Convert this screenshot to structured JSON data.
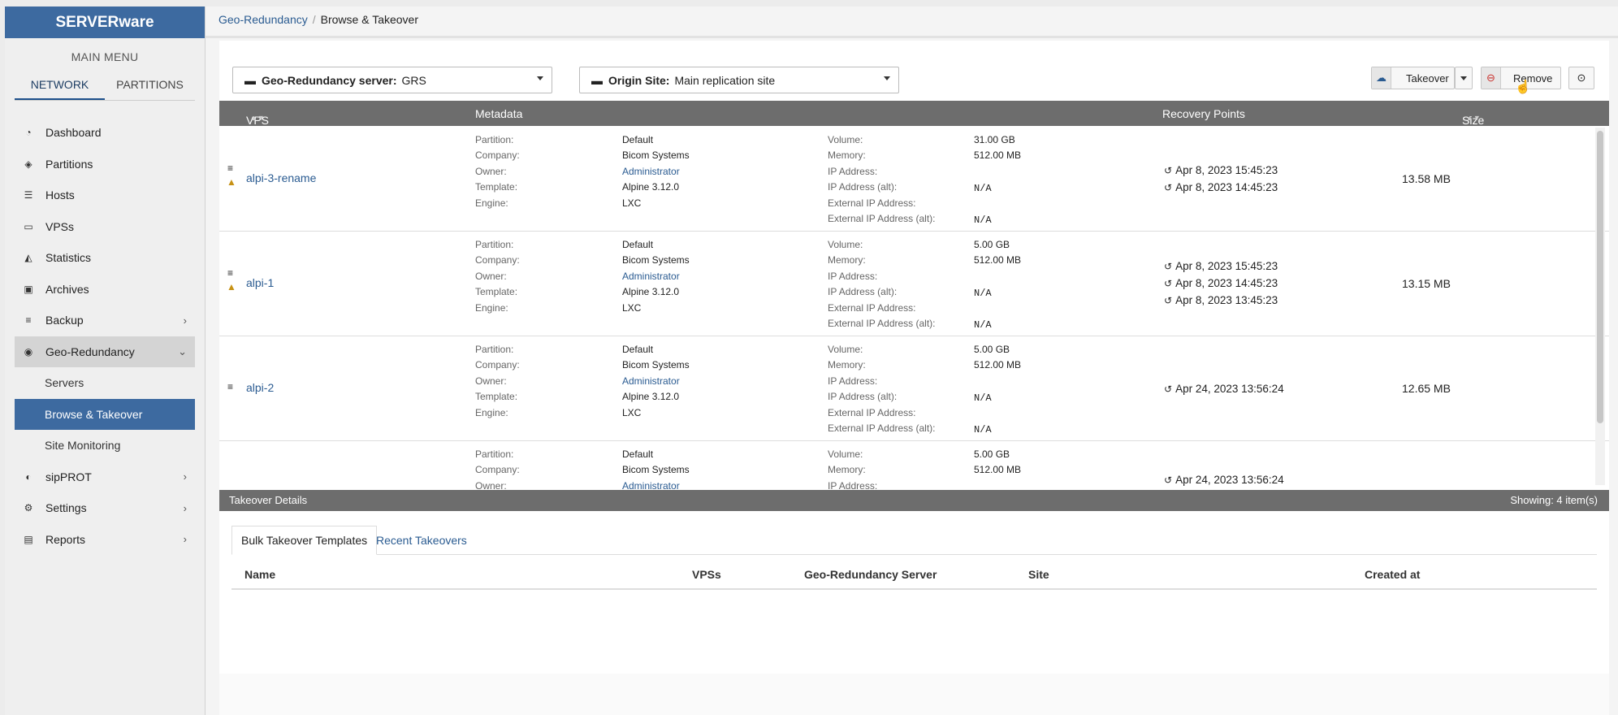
{
  "brand": "SERVERware",
  "menu_title": "MAIN MENU",
  "nav_tabs": [
    "NETWORK",
    "PARTITIONS"
  ],
  "menu": [
    {
      "label": "Dashboard",
      "icon": "dashboard-icon"
    },
    {
      "label": "Partitions",
      "icon": "partitions-icon"
    },
    {
      "label": "Hosts",
      "icon": "hosts-icon"
    },
    {
      "label": "VPSs",
      "icon": "laptop-icon"
    },
    {
      "label": "Statistics",
      "icon": "chart-icon"
    },
    {
      "label": "Archives",
      "icon": "archive-icon"
    },
    {
      "label": "Backup",
      "icon": "database-icon"
    },
    {
      "label": "Geo-Redundancy",
      "icon": "globe-icon"
    },
    {
      "label": "sipPROT",
      "icon": "shield-icon"
    },
    {
      "label": "Settings",
      "icon": "gears-icon"
    },
    {
      "label": "Reports",
      "icon": "report-icon"
    }
  ],
  "submenu": [
    "Servers",
    "Browse & Takeover",
    "Site Monitoring"
  ],
  "breadcrumb": {
    "parent": "Geo-Redundancy",
    "sep": "/",
    "current": "Browse & Takeover"
  },
  "filters": {
    "server_label": "Geo-Redundancy server:",
    "server_value": "GRS",
    "site_label": "Origin Site:",
    "site_value": "Main replication site"
  },
  "actions": {
    "takeover": "Takeover",
    "remove": "Remove"
  },
  "table": {
    "headers": {
      "vps": "VPS",
      "metadata": "Metadata",
      "recovery": "Recovery Points",
      "size": "Size"
    },
    "meta_labels": [
      "Partition:",
      "Company:",
      "Owner:",
      "Template:",
      "Engine:"
    ],
    "net_labels": [
      "Volume:",
      "Memory:",
      "IP Address:",
      "IP Address (alt):",
      "External IP Address:",
      "External IP Address (alt):"
    ],
    "rows": [
      {
        "name": "alpi-3-rename",
        "warn": true,
        "partition": "Default",
        "company": "Bicom Systems",
        "owner": "Administrator",
        "template": "Alpine 3.12.0",
        "engine": "LXC",
        "volume": "31.00 GB",
        "memory": "512.00 MB",
        "ip": "",
        "ip_alt": "N/A",
        "ext_ip": "",
        "ext_ip_alt": "N/A",
        "recovery": [
          "Apr 8, 2023 15:45:23",
          "Apr 8, 2023 14:45:23"
        ],
        "size": "13.58 MB",
        "selected": false
      },
      {
        "name": "alpi-1",
        "warn": true,
        "partition": "Default",
        "company": "Bicom Systems",
        "owner": "Administrator",
        "template": "Alpine 3.12.0",
        "engine": "LXC",
        "volume": "5.00 GB",
        "memory": "512.00 MB",
        "ip": "",
        "ip_alt": "N/A",
        "ext_ip": "",
        "ext_ip_alt": "N/A",
        "recovery": [
          "Apr 8, 2023 15:45:23",
          "Apr 8, 2023 14:45:23",
          "Apr 8, 2023 13:45:23"
        ],
        "size": "13.15 MB",
        "selected": false
      },
      {
        "name": "alpi-2",
        "warn": false,
        "partition": "Default",
        "company": "Bicom Systems",
        "owner": "Administrator",
        "template": "Alpine 3.12.0",
        "engine": "LXC",
        "volume": "5.00 GB",
        "memory": "512.00 MB",
        "ip": "",
        "ip_alt": "N/A",
        "ext_ip": "",
        "ext_ip_alt": "N/A",
        "recovery": [
          "Apr 24, 2023 13:56:24"
        ],
        "size": "12.65 MB",
        "selected": true
      },
      {
        "name": "",
        "warn": false,
        "partition": "Default",
        "company": "Bicom Systems",
        "owner": "Administrator",
        "template": "",
        "engine": "",
        "volume": "5.00 GB",
        "memory": "512.00 MB",
        "ip": "",
        "ip_alt": "",
        "ext_ip": "",
        "ext_ip_alt": "",
        "recovery": [
          "Apr 24, 2023 13:56:24"
        ],
        "size": "",
        "selected": false
      }
    ]
  },
  "details": {
    "title": "Takeover Details",
    "showing": "Showing: 4 item(s)"
  },
  "bottom_tabs": [
    "Bulk Takeover Templates",
    "Recent Takeovers"
  ],
  "bottom_headers": [
    "Name",
    "VPSs",
    "Geo-Redundancy Server",
    "Site",
    "Created at"
  ],
  "colors": {
    "brand": "#3d6aa0",
    "link": "#2a5b91",
    "header": "#6d6d6d",
    "selected": "#2a6fc8"
  }
}
